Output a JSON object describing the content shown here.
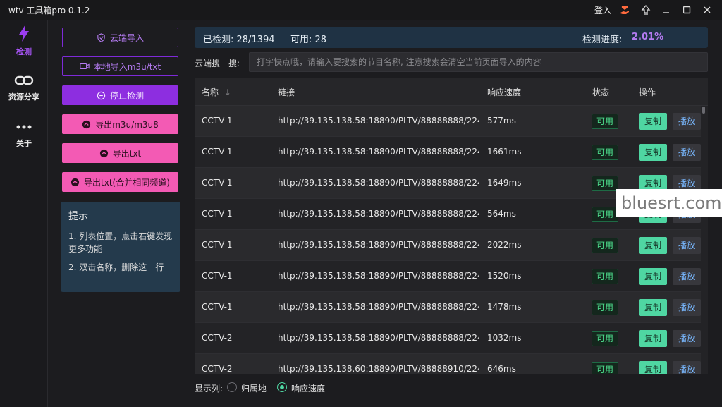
{
  "app": {
    "title": "wtv 工具箱pro 0.1.2",
    "login_label": "登入",
    "icons": [
      "hand-heart-icon",
      "upload-icon",
      "minimize-icon",
      "maximize-icon",
      "close-icon"
    ]
  },
  "nav": {
    "items": [
      {
        "label": "检测",
        "icon": "lightning-icon",
        "active": true
      },
      {
        "label": "资源分享",
        "icon": "link-icon",
        "active": false
      },
      {
        "label": "关于",
        "icon": "more-dots-icon",
        "active": false
      }
    ]
  },
  "actions": {
    "cloud_import": "云端导入",
    "local_import": "本地导入m3u/txt",
    "stop_check": "停止检测",
    "export_m3u": "导出m3u/m3u8",
    "export_txt": "导出txt",
    "export_txt_merge": "导出txt(合并相同频道)"
  },
  "tips": {
    "title": "提示",
    "line1": "1. 列表位置，点击右键发现更多功能",
    "line2": "2. 双击名称，删除这一行"
  },
  "status": {
    "checked": "已检测: 28/1394",
    "available": "可用: 28",
    "progress_label": "检测进度:",
    "progress_value": "2.01%"
  },
  "search": {
    "label": "云端搜一搜:",
    "placeholder": "打字快点哦，请输入要搜索的节目名称, 注意搜索会清空当前页面导入的内容"
  },
  "table": {
    "headers": {
      "name": "名称",
      "link": "链接",
      "speed": "响应速度",
      "status": "状态",
      "ops": "操作"
    },
    "rows": [
      {
        "name": "CCTV-1",
        "link": "http://39.135.138.58:18890/PLTV/88888888/224...",
        "speed": "577ms",
        "status": "可用",
        "copy": "复制",
        "play": "播放"
      },
      {
        "name": "CCTV-1",
        "link": "http://39.135.138.58:18890/PLTV/88888888/224...",
        "speed": "1661ms",
        "status": "可用",
        "copy": "复制",
        "play": "播放"
      },
      {
        "name": "CCTV-1",
        "link": "http://39.135.138.58:18890/PLTV/88888888/224...",
        "speed": "1649ms",
        "status": "可用",
        "copy": "复制",
        "play": "播放"
      },
      {
        "name": "CCTV-1",
        "link": "http://39.135.138.58:18890/PLTV/88888888/224...",
        "speed": "564ms",
        "status": "可用",
        "copy": "复制",
        "play": "播放"
      },
      {
        "name": "CCTV-1",
        "link": "http://39.135.138.58:18890/PLTV/88888888/224...",
        "speed": "2022ms",
        "status": "可用",
        "copy": "复制",
        "play": "播放"
      },
      {
        "name": "CCTV-1",
        "link": "http://39.135.138.58:18890/PLTV/88888888/224...",
        "speed": "1520ms",
        "status": "可用",
        "copy": "复制",
        "play": "播放"
      },
      {
        "name": "CCTV-1",
        "link": "http://39.135.138.58:18890/PLTV/88888888/224...",
        "speed": "1478ms",
        "status": "可用",
        "copy": "复制",
        "play": "播放"
      },
      {
        "name": "CCTV-2",
        "link": "http://39.135.138.58:18890/PLTV/88888888/224...",
        "speed": "1032ms",
        "status": "可用",
        "copy": "复制",
        "play": "播放"
      },
      {
        "name": "CCTV-2",
        "link": "http://39.135.138.60:18890/PLTV/88888910/224...",
        "speed": "646ms",
        "status": "可用",
        "copy": "复制",
        "play": "播放"
      }
    ]
  },
  "footer": {
    "label": "显示列:",
    "options": [
      {
        "label": "归属地",
        "selected": false
      },
      {
        "label": "响应速度",
        "selected": true
      }
    ]
  },
  "watermark": "bluesrt.com",
  "colors": {
    "accent_purple": "#8d2ee0",
    "accent_pink": "#f35ab4",
    "accent_green": "#4fd6a2",
    "status_bar_bg": "#1f3244"
  }
}
